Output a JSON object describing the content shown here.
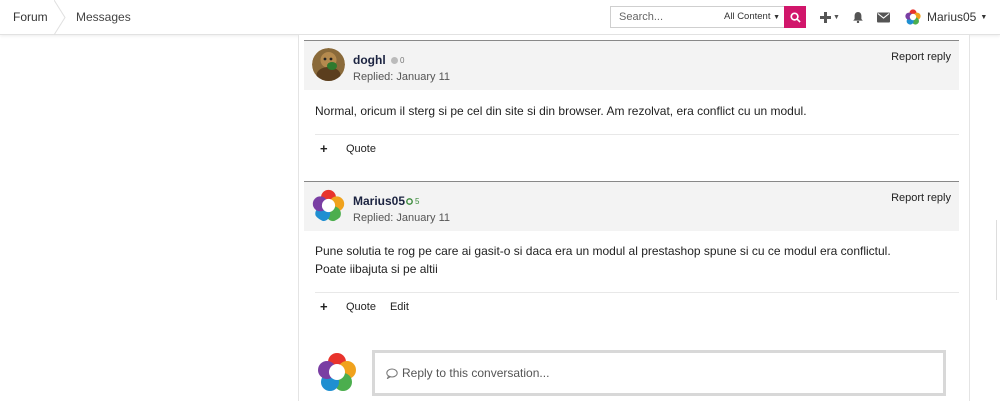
{
  "nav": {
    "breadcrumb_forum": "Forum",
    "breadcrumb_messages": "Messages"
  },
  "search": {
    "placeholder": "Search...",
    "scope": "All Content"
  },
  "user": {
    "name": "Marius05"
  },
  "posts": [
    {
      "author": "doghl",
      "reputation": "0",
      "replied": "Replied: January 11",
      "report": "Report reply",
      "body": "Normal, oricum il sterg si pe cel din site si din browser. Am rezolvat, era conflict cu un modul.",
      "quote": "Quote"
    },
    {
      "author": "Marius05",
      "reputation": "5",
      "replied": "Replied: January 11",
      "report": "Report reply",
      "body": "Pune solutia te rog pe care ai gasit-o si daca era un modul al prestashop spune si cu ce modul era conflictul. Poate iibajuta si pe altii",
      "quote": "Quote",
      "edit": "Edit"
    }
  ],
  "reply": {
    "placeholder": "Reply to this conversation..."
  },
  "colors": {
    "accent": "#d1166b",
    "author": "#1b2340"
  }
}
